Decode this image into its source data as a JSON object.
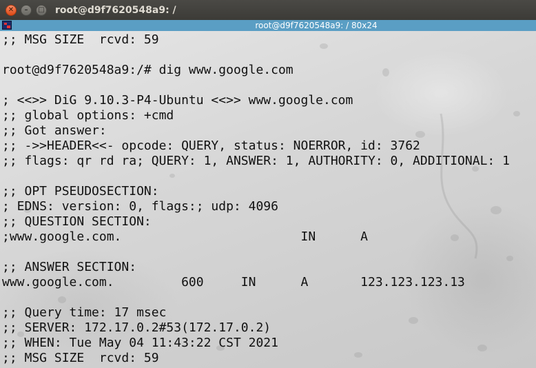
{
  "window": {
    "title": "root@d9f7620548a9: /",
    "xterm_title": "root@d9f7620548a9: / 80x24"
  },
  "icons": {
    "close": "close-icon",
    "minimize": "minimize-icon",
    "maximize": "maximize-icon",
    "xterm": "xterm-icon"
  },
  "colors": {
    "titlebar": "#3c3b37",
    "close_button": "#df4a16",
    "xterm_bar": "#5a9ec4",
    "terminal_text": "#111111"
  },
  "terminal": {
    "lines": [
      ";; MSG SIZE  rcvd: 59",
      "",
      "root@d9f7620548a9:/# dig www.google.com",
      "",
      "; <<>> DiG 9.10.3-P4-Ubuntu <<>> www.google.com",
      ";; global options: +cmd",
      ";; Got answer:",
      ";; ->>HEADER<<- opcode: QUERY, status: NOERROR, id: 3762",
      ";; flags: qr rd ra; QUERY: 1, ANSWER: 1, AUTHORITY: 0, ADDITIONAL: 1",
      "",
      ";; OPT PSEUDOSECTION:",
      "; EDNS: version: 0, flags:; udp: 4096",
      ";; QUESTION SECTION:",
      ";www.google.com.                        IN      A",
      "",
      ";; ANSWER SECTION:",
      "www.google.com.         600     IN      A       123.123.123.13",
      "",
      ";; Query time: 17 msec",
      ";; SERVER: 172.17.0.2#53(172.17.0.2)",
      ";; WHEN: Tue May 04 11:43:22 CST 2021",
      ";; MSG SIZE  rcvd: 59"
    ]
  }
}
